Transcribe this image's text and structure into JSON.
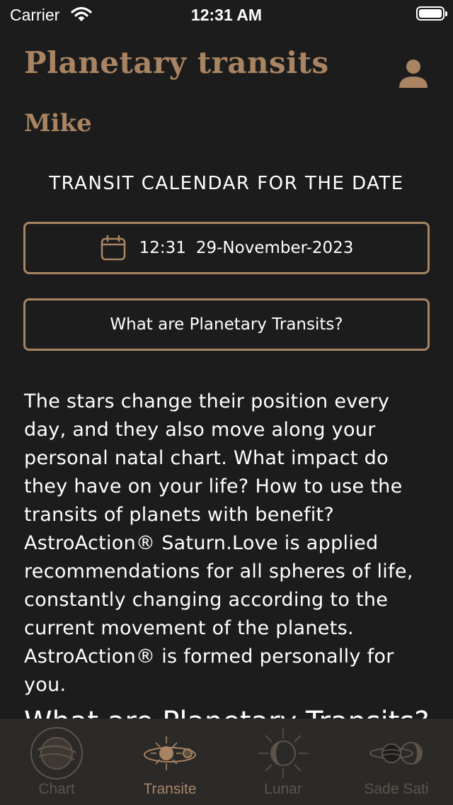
{
  "status_bar": {
    "carrier": "Carrier",
    "time": "12:31 AM"
  },
  "header": {
    "title": "Planetary transits",
    "user_name": "Mike"
  },
  "calendar": {
    "heading": "TRANSIT CALENDAR FOR THE DATE",
    "time": "12:31",
    "date": "29-November-2023"
  },
  "info_button_label": "What are Planetary Transits?",
  "description": "The stars change their position every day, and they also move along your personal natal chart. What impact do they have on your life? How to use the transits of planets with benefit? AstroAction® Saturn.Love is applied recommendations for all spheres of life, constantly changing according to the current movement of the planets. AstroAction® is formed personally for you.",
  "sub_heading": "What are Planetary Transits?",
  "tabs": [
    {
      "label": "Chart",
      "icon": "chart-icon",
      "active": false
    },
    {
      "label": "Transite",
      "icon": "transite-icon",
      "active": true
    },
    {
      "label": "Lunar",
      "icon": "lunar-icon",
      "active": false
    },
    {
      "label": "Sade Sati",
      "icon": "sade-sati-icon",
      "active": false
    }
  ],
  "colors": {
    "accent": "#a88462",
    "background": "#1c1c1c",
    "tab_bar": "#2b2a29",
    "inactive_tab": "#5e5348"
  }
}
